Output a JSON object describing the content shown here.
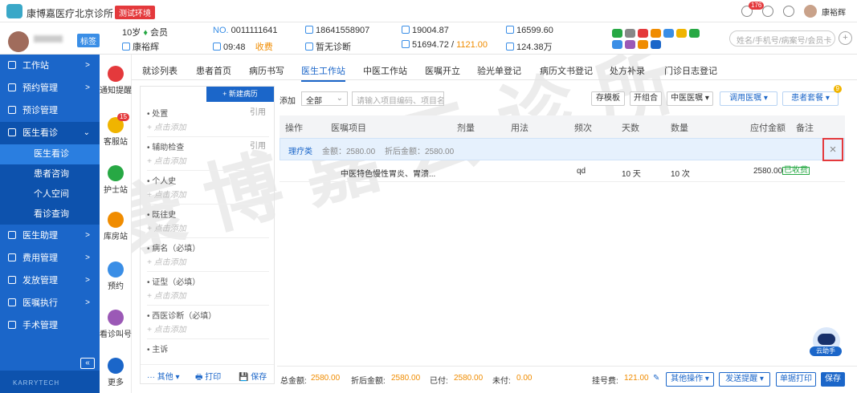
{
  "app": {
    "title": "康博嘉医疗北京诊所",
    "env_tag": "测试环境",
    "watermark": "康博嘉云诊所"
  },
  "topbar": {
    "notif_count": "176",
    "user_name": "康裕辉"
  },
  "patient": {
    "tag": "标签",
    "age": "10岁",
    "member": "会员",
    "doctor": "康裕辉",
    "no": "0011111641",
    "time": "09:48",
    "charge_status": "收费",
    "phone": "18641558907",
    "diagnosis": "暂无诊断",
    "bal1": "19004.87",
    "bal2a": "51694.72",
    "bal2b": "1121.00",
    "bal3": "16599.60",
    "bal4": "124.38万"
  },
  "global_search": {
    "placeholder": "姓名/手机号/病案号/会员卡"
  },
  "sidebar": {
    "items": [
      {
        "label": "工作站",
        "arrow": ">"
      },
      {
        "label": "预约管理",
        "arrow": ">"
      },
      {
        "label": "预诊管理",
        "arrow": ""
      },
      {
        "label": "医生看诊",
        "arrow": "⌄"
      },
      {
        "label": "医生助理",
        "arrow": ">"
      },
      {
        "label": "费用管理",
        "arrow": ">"
      },
      {
        "label": "发放管理",
        "arrow": ">"
      },
      {
        "label": "医嘱执行",
        "arrow": ">"
      },
      {
        "label": "手术管理",
        "arrow": ""
      }
    ],
    "subs": [
      "医生看诊",
      "患者咨询",
      "个人空间",
      "看诊查询"
    ],
    "collapse": "«",
    "footer": "KARRYTECH"
  },
  "quick": [
    {
      "label": "通知提醒",
      "badge": ""
    },
    {
      "label": "客服站",
      "badge": "15"
    },
    {
      "label": "护士站",
      "badge": ""
    },
    {
      "label": "库房站",
      "badge": ""
    },
    {
      "label": "预约",
      "badge": ""
    },
    {
      "label": "看诊叫号",
      "badge": ""
    },
    {
      "label": "更多",
      "badge": ""
    }
  ],
  "tabs": [
    "就诊列表",
    "患者首页",
    "病历书写",
    "医生工作站",
    "中医工作站",
    "医嘱开立",
    "验光单登记",
    "病历文书登记",
    "处方补录",
    "门诊日志登记"
  ],
  "record": {
    "new_btn": "+ 新建病历",
    "sections": [
      {
        "label": "• 处置",
        "right": "引用",
        "add": "+ 点击添加"
      },
      {
        "label": "• 辅助检查",
        "right": "引用",
        "add": "+ 点击添加"
      },
      {
        "label": "• 个人史",
        "right": "",
        "add": "+ 点击添加"
      },
      {
        "label": "• 既往史",
        "right": "",
        "add": "+ 点击添加"
      },
      {
        "label": "• 病名（必填）",
        "right": "",
        "add": "+ 点击添加"
      },
      {
        "label": "• 证型（必填）",
        "right": "",
        "add": "+ 点击添加"
      },
      {
        "label": "• 西医诊断（必填）",
        "right": "",
        "add": "+ 点击添加"
      },
      {
        "label": "• 主诉",
        "right": "",
        "add": ""
      }
    ],
    "more": "··· 其他 ▾",
    "print": "🖶 打印",
    "save": "💾 保存"
  },
  "toolbar": {
    "add_label": "添加",
    "select": "全部",
    "search_placeholder": "请输入项目编码、项目名",
    "save_tpl": "存模板",
    "combo": "开组合",
    "tcm": "中医医嘱 ▾",
    "template": "调用医嘱 ▾",
    "package": "患者套餐 ▾",
    "package_badge": "9"
  },
  "table": {
    "headers": [
      "操作",
      "医嘱项目",
      "剂量",
      "用法",
      "频次",
      "天数",
      "数量",
      "应付金额",
      "备注"
    ],
    "category": {
      "name": "理疗类",
      "amount": "金额：2580.00",
      "discount": "折后金额：2580.00"
    },
    "rows": [
      {
        "item": "中医特色慢性胃炎、胃溃...",
        "freq": "qd",
        "days": "10 天",
        "qty": "10 次",
        "amount": "2580.00",
        "tag": "已收费"
      }
    ],
    "delete": "×"
  },
  "bottom": {
    "total_label": "总金额:",
    "total": "2580.00",
    "disc_label": "折后金额:",
    "disc": "2580.00",
    "paid_label": "已付:",
    "paid": "2580.00",
    "unpaid_label": "未付:",
    "unpaid": "0.00",
    "reg_label": "挂号费:",
    "reg": "121.00",
    "other": "其他操作 ▾",
    "send": "发送提醒 ▾",
    "print_btn": "单据打印",
    "save_btn": "保存"
  },
  "assistant": {
    "label": "云助手"
  }
}
